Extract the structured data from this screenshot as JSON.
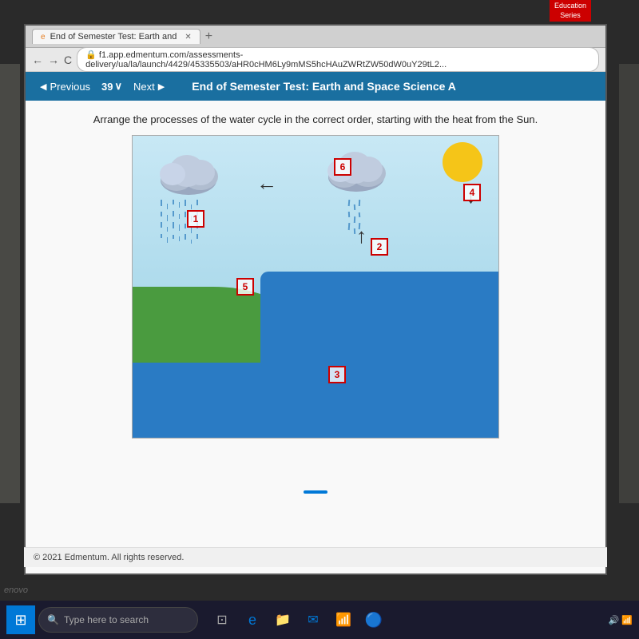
{
  "browser": {
    "tab_title": "End of Semester Test: Earth and",
    "tab_favicon": "e",
    "address": "f1.app.edmentum.com/assessments-delivery/ua/la/launch/4429/45335503/aHR0cHM6Ly9mMS5hcHAuZWRtZW50dW0uY29tL2...",
    "secure_icon": "🔒",
    "nav_back": "←",
    "nav_forward": "→",
    "nav_refresh": "C"
  },
  "toolbar": {
    "previous_label": "Previous",
    "next_label": "Next",
    "question_number": "39",
    "chevron_icon": "∨",
    "title": "End of Semester Test: Earth and Space Science A",
    "previous_icon": "◀",
    "next_icon": "▶"
  },
  "question": {
    "text": "Arrange the processes of the water cycle in the correct order, starting with the heat from the Sun.",
    "numbers": [
      "1",
      "2",
      "3",
      "4",
      "5",
      "6"
    ]
  },
  "footer": {
    "copyright": "© 2021 Edmentum. All rights reserved."
  },
  "taskbar": {
    "search_placeholder": "Type here to search",
    "start_icon": "⊞"
  },
  "education_logo": {
    "line1": "Education",
    "line2": "Series"
  }
}
